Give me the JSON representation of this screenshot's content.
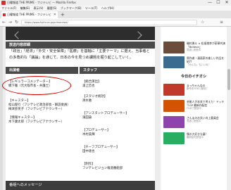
{
  "window": {
    "title": "日曜報道 THE PRIME - フジテレビ — Mozilla Firefox",
    "minimize": "—",
    "maximize": "☐",
    "close": "✕"
  },
  "menu": [
    "ファイル(F)",
    "編集(E)",
    "表示(V)",
    "履歴(S)",
    "ブックマーク(B)",
    "ツール(T)",
    "ヘルプ(H)"
  ],
  "tab": {
    "label": "日曜報道 THE PRIME - フジテレビ",
    "close": "✕",
    "new": "+"
  },
  "nav": {
    "back": "←",
    "forward": "→",
    "reload": "↻",
    "url": "https://www.fujitv.co.jp/primenews/",
    "bookmark": "☆",
    "menu": "≡"
  },
  "main": {
    "topband_arrow_hint": "",
    "section_title": "放送内容詳細",
    "description": "「政治」「経済」「外交・安全保障」「医療」を基軸に「主要テーマ」に据え、当事者との多角的な「議論」を通じて、日本の今を見つめ課題を掘り起こしていく。",
    "cast_header": "出演者",
    "staff_header": "スタッフ",
    "cast": [
      {
        "role": "【レギュラーコメンテーター】",
        "name": "橋下徹（元大阪市長・弁護士）"
      },
      {
        "role": "【キャスター】",
        "name": "松山俊行（フジテレビ政治部長・解説委員）"
      },
      {
        "role": "",
        "name": "梅津弥英子（フジテレビアナウンサー）"
      },
      {
        "role": "【情報キャスター】",
        "name": "木下康太郎（フジテレビアナウンサー）"
      }
    ],
    "staff": [
      {
        "role": "【総合演出】",
        "name": "浦上哲也"
      },
      {
        "role": "【スタジオ統括】",
        "name": "清水勉"
      },
      {
        "role": "【アシスタントプロデューサー】",
        "name": "濱田諭"
      },
      {
        "role": "【プロデューサー】",
        "name": "木村美輝"
      },
      {
        "role": "【チーフプロデューサー】",
        "name": "田中達也"
      },
      {
        "role": "【制作】",
        "name": "フジテレビジョン報道番組部"
      }
    ],
    "message_header": "番組へのメッセージ"
  },
  "side": {
    "top_items": [
      {
        "title": "磯村勇斗 × 松坂桃李が豪華共演「Believe」",
        "sub": "見逃し配信中",
        "color": "#6b4c3b"
      },
      {
        "title": "原作者・漫画家の楽しい作品を紹介",
        "sub": "「みんな」もいいね！",
        "color": "#3b6b8e"
      }
    ],
    "pickup_title": "今日のイチオシ",
    "pickup_items": [
      {
        "title": "まっちゃんねる",
        "sub": "新作をFODで配信！",
        "color": "#c0392b"
      },
      {
        "title": "芸能人が本気で考えた！ドッキリGP 最新作配信",
        "sub": "FODで配信中",
        "color": "#d35400"
      },
      {
        "title": "さんまのお笑い向上委員会",
        "sub": "見逃し配信中",
        "color": "#8e44ad"
      },
      {
        "title": "僕の大好きな妻！",
        "sub": "最新話を配信中",
        "color": "#27ae60"
      }
    ]
  },
  "colors": {
    "header_bg": "#4a4a4a",
    "annotation": "#d00000"
  }
}
